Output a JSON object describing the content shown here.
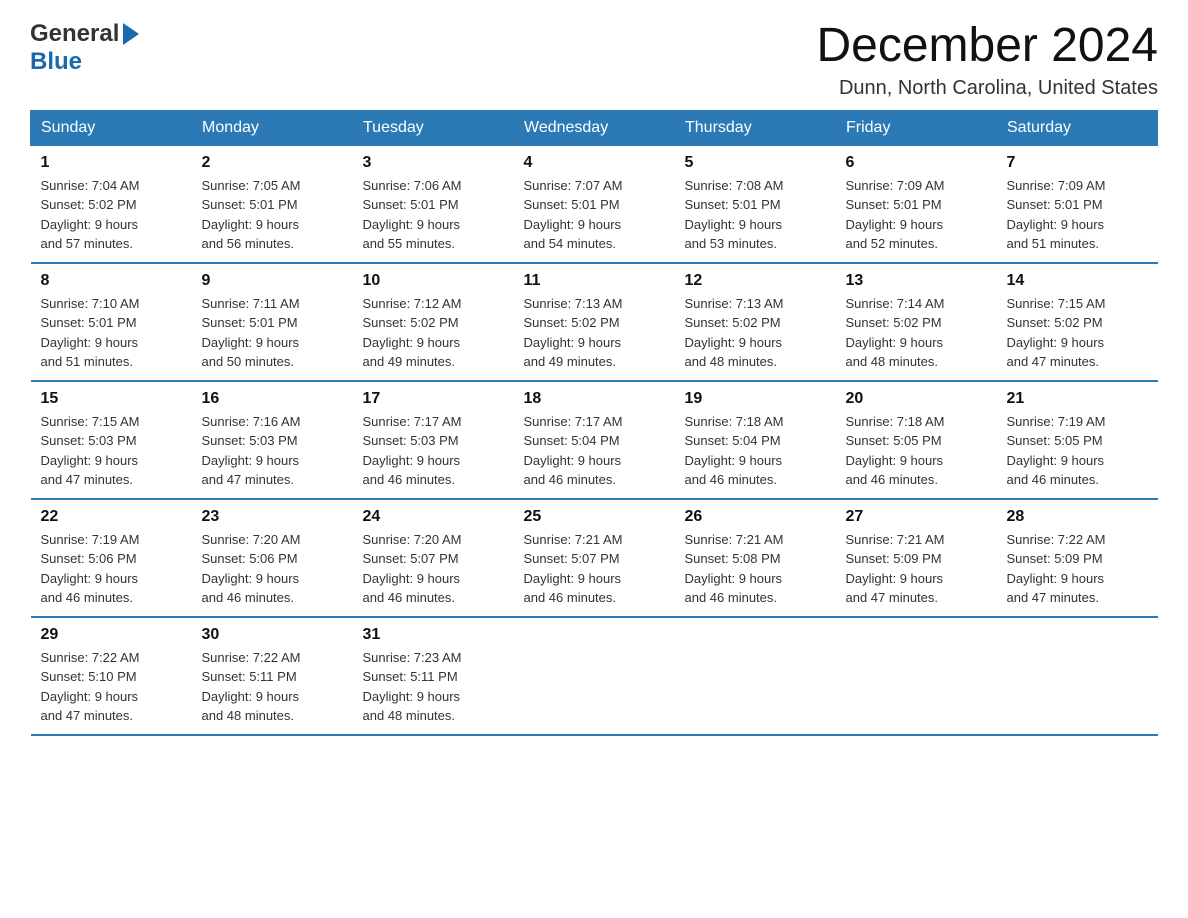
{
  "header": {
    "logo_general": "General",
    "logo_blue": "Blue",
    "month_title": "December 2024",
    "location": "Dunn, North Carolina, United States"
  },
  "weekdays": [
    "Sunday",
    "Monday",
    "Tuesday",
    "Wednesday",
    "Thursday",
    "Friday",
    "Saturday"
  ],
  "weeks": [
    [
      {
        "day": "1",
        "sunrise": "Sunrise: 7:04 AM",
        "sunset": "Sunset: 5:02 PM",
        "daylight": "Daylight: 9 hours",
        "daylight2": "and 57 minutes."
      },
      {
        "day": "2",
        "sunrise": "Sunrise: 7:05 AM",
        "sunset": "Sunset: 5:01 PM",
        "daylight": "Daylight: 9 hours",
        "daylight2": "and 56 minutes."
      },
      {
        "day": "3",
        "sunrise": "Sunrise: 7:06 AM",
        "sunset": "Sunset: 5:01 PM",
        "daylight": "Daylight: 9 hours",
        "daylight2": "and 55 minutes."
      },
      {
        "day": "4",
        "sunrise": "Sunrise: 7:07 AM",
        "sunset": "Sunset: 5:01 PM",
        "daylight": "Daylight: 9 hours",
        "daylight2": "and 54 minutes."
      },
      {
        "day": "5",
        "sunrise": "Sunrise: 7:08 AM",
        "sunset": "Sunset: 5:01 PM",
        "daylight": "Daylight: 9 hours",
        "daylight2": "and 53 minutes."
      },
      {
        "day": "6",
        "sunrise": "Sunrise: 7:09 AM",
        "sunset": "Sunset: 5:01 PM",
        "daylight": "Daylight: 9 hours",
        "daylight2": "and 52 minutes."
      },
      {
        "day": "7",
        "sunrise": "Sunrise: 7:09 AM",
        "sunset": "Sunset: 5:01 PM",
        "daylight": "Daylight: 9 hours",
        "daylight2": "and 51 minutes."
      }
    ],
    [
      {
        "day": "8",
        "sunrise": "Sunrise: 7:10 AM",
        "sunset": "Sunset: 5:01 PM",
        "daylight": "Daylight: 9 hours",
        "daylight2": "and 51 minutes."
      },
      {
        "day": "9",
        "sunrise": "Sunrise: 7:11 AM",
        "sunset": "Sunset: 5:01 PM",
        "daylight": "Daylight: 9 hours",
        "daylight2": "and 50 minutes."
      },
      {
        "day": "10",
        "sunrise": "Sunrise: 7:12 AM",
        "sunset": "Sunset: 5:02 PM",
        "daylight": "Daylight: 9 hours",
        "daylight2": "and 49 minutes."
      },
      {
        "day": "11",
        "sunrise": "Sunrise: 7:13 AM",
        "sunset": "Sunset: 5:02 PM",
        "daylight": "Daylight: 9 hours",
        "daylight2": "and 49 minutes."
      },
      {
        "day": "12",
        "sunrise": "Sunrise: 7:13 AM",
        "sunset": "Sunset: 5:02 PM",
        "daylight": "Daylight: 9 hours",
        "daylight2": "and 48 minutes."
      },
      {
        "day": "13",
        "sunrise": "Sunrise: 7:14 AM",
        "sunset": "Sunset: 5:02 PM",
        "daylight": "Daylight: 9 hours",
        "daylight2": "and 48 minutes."
      },
      {
        "day": "14",
        "sunrise": "Sunrise: 7:15 AM",
        "sunset": "Sunset: 5:02 PM",
        "daylight": "Daylight: 9 hours",
        "daylight2": "and 47 minutes."
      }
    ],
    [
      {
        "day": "15",
        "sunrise": "Sunrise: 7:15 AM",
        "sunset": "Sunset: 5:03 PM",
        "daylight": "Daylight: 9 hours",
        "daylight2": "and 47 minutes."
      },
      {
        "day": "16",
        "sunrise": "Sunrise: 7:16 AM",
        "sunset": "Sunset: 5:03 PM",
        "daylight": "Daylight: 9 hours",
        "daylight2": "and 47 minutes."
      },
      {
        "day": "17",
        "sunrise": "Sunrise: 7:17 AM",
        "sunset": "Sunset: 5:03 PM",
        "daylight": "Daylight: 9 hours",
        "daylight2": "and 46 minutes."
      },
      {
        "day": "18",
        "sunrise": "Sunrise: 7:17 AM",
        "sunset": "Sunset: 5:04 PM",
        "daylight": "Daylight: 9 hours",
        "daylight2": "and 46 minutes."
      },
      {
        "day": "19",
        "sunrise": "Sunrise: 7:18 AM",
        "sunset": "Sunset: 5:04 PM",
        "daylight": "Daylight: 9 hours",
        "daylight2": "and 46 minutes."
      },
      {
        "day": "20",
        "sunrise": "Sunrise: 7:18 AM",
        "sunset": "Sunset: 5:05 PM",
        "daylight": "Daylight: 9 hours",
        "daylight2": "and 46 minutes."
      },
      {
        "day": "21",
        "sunrise": "Sunrise: 7:19 AM",
        "sunset": "Sunset: 5:05 PM",
        "daylight": "Daylight: 9 hours",
        "daylight2": "and 46 minutes."
      }
    ],
    [
      {
        "day": "22",
        "sunrise": "Sunrise: 7:19 AM",
        "sunset": "Sunset: 5:06 PM",
        "daylight": "Daylight: 9 hours",
        "daylight2": "and 46 minutes."
      },
      {
        "day": "23",
        "sunrise": "Sunrise: 7:20 AM",
        "sunset": "Sunset: 5:06 PM",
        "daylight": "Daylight: 9 hours",
        "daylight2": "and 46 minutes."
      },
      {
        "day": "24",
        "sunrise": "Sunrise: 7:20 AM",
        "sunset": "Sunset: 5:07 PM",
        "daylight": "Daylight: 9 hours",
        "daylight2": "and 46 minutes."
      },
      {
        "day": "25",
        "sunrise": "Sunrise: 7:21 AM",
        "sunset": "Sunset: 5:07 PM",
        "daylight": "Daylight: 9 hours",
        "daylight2": "and 46 minutes."
      },
      {
        "day": "26",
        "sunrise": "Sunrise: 7:21 AM",
        "sunset": "Sunset: 5:08 PM",
        "daylight": "Daylight: 9 hours",
        "daylight2": "and 46 minutes."
      },
      {
        "day": "27",
        "sunrise": "Sunrise: 7:21 AM",
        "sunset": "Sunset: 5:09 PM",
        "daylight": "Daylight: 9 hours",
        "daylight2": "and 47 minutes."
      },
      {
        "day": "28",
        "sunrise": "Sunrise: 7:22 AM",
        "sunset": "Sunset: 5:09 PM",
        "daylight": "Daylight: 9 hours",
        "daylight2": "and 47 minutes."
      }
    ],
    [
      {
        "day": "29",
        "sunrise": "Sunrise: 7:22 AM",
        "sunset": "Sunset: 5:10 PM",
        "daylight": "Daylight: 9 hours",
        "daylight2": "and 47 minutes."
      },
      {
        "day": "30",
        "sunrise": "Sunrise: 7:22 AM",
        "sunset": "Sunset: 5:11 PM",
        "daylight": "Daylight: 9 hours",
        "daylight2": "and 48 minutes."
      },
      {
        "day": "31",
        "sunrise": "Sunrise: 7:23 AM",
        "sunset": "Sunset: 5:11 PM",
        "daylight": "Daylight: 9 hours",
        "daylight2": "and 48 minutes."
      },
      {
        "day": "",
        "sunrise": "",
        "sunset": "",
        "daylight": "",
        "daylight2": ""
      },
      {
        "day": "",
        "sunrise": "",
        "sunset": "",
        "daylight": "",
        "daylight2": ""
      },
      {
        "day": "",
        "sunrise": "",
        "sunset": "",
        "daylight": "",
        "daylight2": ""
      },
      {
        "day": "",
        "sunrise": "",
        "sunset": "",
        "daylight": "",
        "daylight2": ""
      }
    ]
  ]
}
